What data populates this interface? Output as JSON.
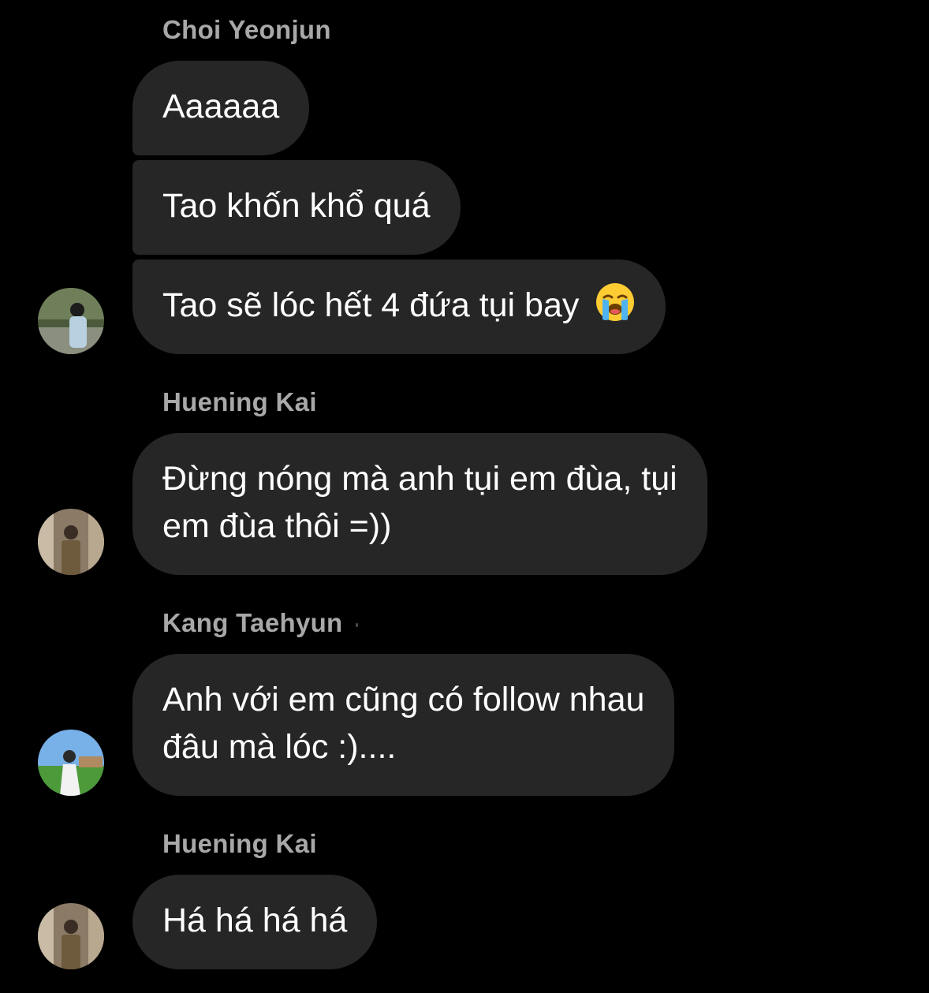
{
  "messages": [
    {
      "sender": "Choi Yeonjun",
      "bubbles": [
        "Aaaaaa",
        "Tao khốn khổ quá",
        "Tao sẽ lóc hết 4 đứa tụi bay"
      ],
      "emoji": "loudly-crying-face-icon"
    },
    {
      "sender": "Huening Kai",
      "lines": [
        "Đừng nóng mà anh tụi em đùa, tụi",
        "em đùa thôi =))"
      ]
    },
    {
      "sender": "Kang Taehyun",
      "lines": [
        "Anh với em cũng có follow nhau",
        "đâu mà lóc :)...."
      ]
    },
    {
      "sender": "Huening Kai",
      "lines": [
        "Há há há há"
      ]
    }
  ],
  "colors": {
    "background": "#000000",
    "bubble": "#262626",
    "sender_name": "#a8a8a8",
    "message_text": "#ffffff"
  }
}
